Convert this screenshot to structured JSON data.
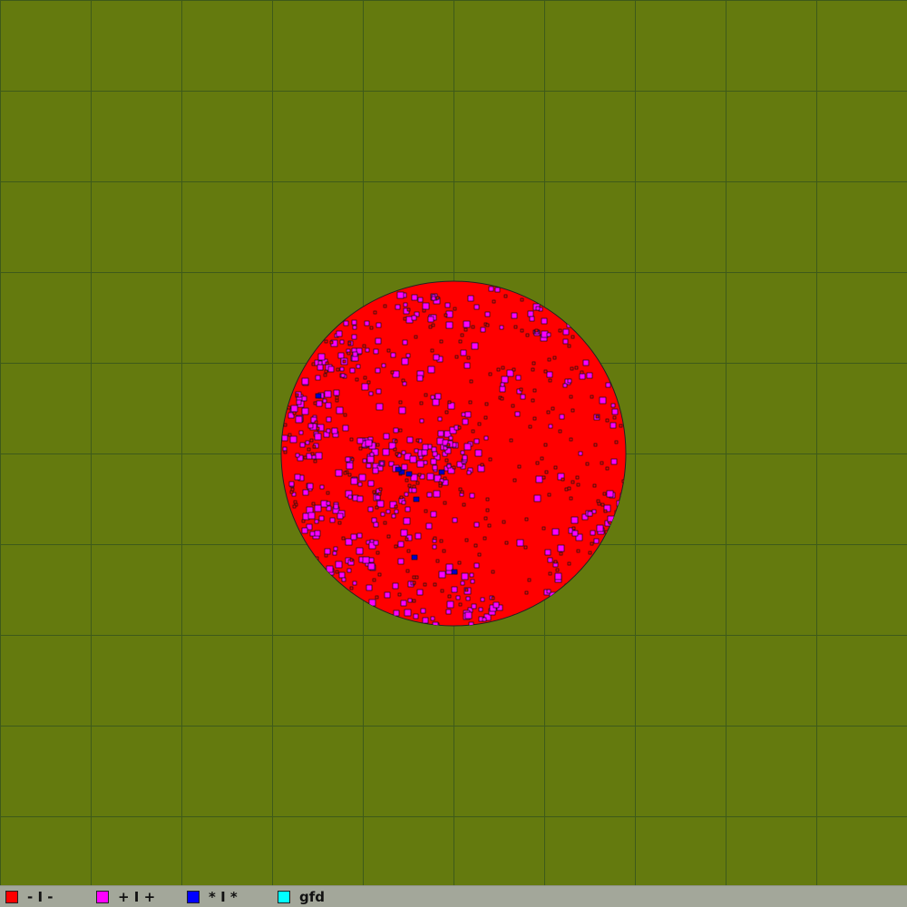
{
  "map": {
    "background_color": "#647a0e",
    "grid_line_color": "#3e5a1a",
    "grid_rows": 10,
    "grid_cols": 10
  },
  "territory": {
    "shape": "circle",
    "primary_color": "#ff0000",
    "secondary_color": "#ff00ff",
    "tertiary_color": "#0000cc",
    "cell_border_color": "#111111"
  },
  "legend": {
    "items": [
      {
        "label": "- I -",
        "color": "#ff0000"
      },
      {
        "label": "+ I +",
        "color": "#ff00ff"
      },
      {
        "label": "* I *",
        "color": "#0000ff"
      },
      {
        "label": "gfd",
        "color": "#00ffff"
      }
    ]
  }
}
